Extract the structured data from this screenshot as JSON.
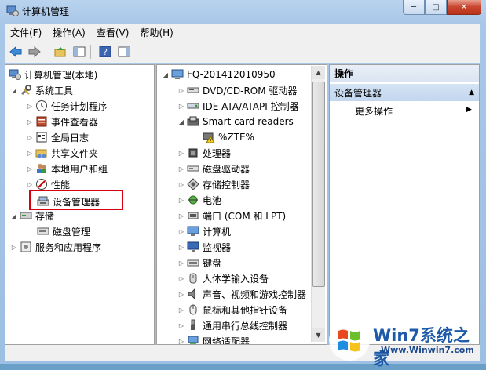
{
  "window": {
    "title": "计算机管理",
    "min_label": "─",
    "max_label": "□",
    "close_label": "✕"
  },
  "menu": [
    "文件(F)",
    "操作(A)",
    "查看(V)",
    "帮助(H)"
  ],
  "left_tree": {
    "root": "计算机管理(本地)",
    "system_tools": "系统工具",
    "items": [
      "任务计划程序",
      "事件查看器",
      "全局日志",
      "共享文件夹",
      "本地用户和组",
      "性能",
      "设备管理器"
    ],
    "storage": "存储",
    "disk_mgmt": "磁盘管理",
    "services": "服务和应用程序"
  },
  "device_tree": {
    "computer": "FQ-201412010950",
    "items": [
      "DVD/CD-ROM 驱动器",
      "IDE ATA/ATAPI 控制器",
      "Smart card readers",
      "%ZTE%",
      "处理器",
      "磁盘驱动器",
      "存储控制器",
      "电池",
      "端口 (COM 和 LPT)",
      "计算机",
      "监视器",
      "键盘",
      "人体学输入设备",
      "声音、视频和游戏控制器",
      "鼠标和其他指针设备",
      "通用串行总线控制器",
      "网络适配器"
    ]
  },
  "actions": {
    "header": "操作",
    "section": "设备管理器",
    "more": "更多操作"
  },
  "watermark": {
    "text": "Win7系统之家",
    "url": "Www.Winwin7.com"
  }
}
